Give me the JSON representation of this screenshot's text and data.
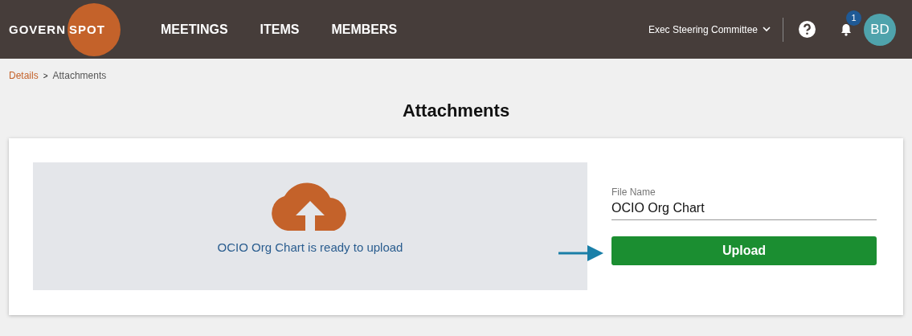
{
  "header": {
    "logo": {
      "left": "GOVERN",
      "right": "SPOT"
    },
    "nav": [
      {
        "label": "MEETINGS"
      },
      {
        "label": "ITEMS"
      },
      {
        "label": "MEMBERS"
      }
    ],
    "committee": "Exec Steering Committee",
    "notification_count": "1",
    "avatar": "BD"
  },
  "breadcrumb": [
    {
      "label": "Details",
      "kind": "link"
    },
    {
      "label": ">",
      "kind": "separator"
    },
    {
      "label": "Attachments",
      "kind": "current"
    }
  ],
  "title": "Attachments",
  "dropzone": {
    "message": "OCIO Org Chart is ready to upload"
  },
  "file_name": {
    "label": "File Name",
    "value": "OCIO Org Chart"
  },
  "upload_button": "Upload"
}
